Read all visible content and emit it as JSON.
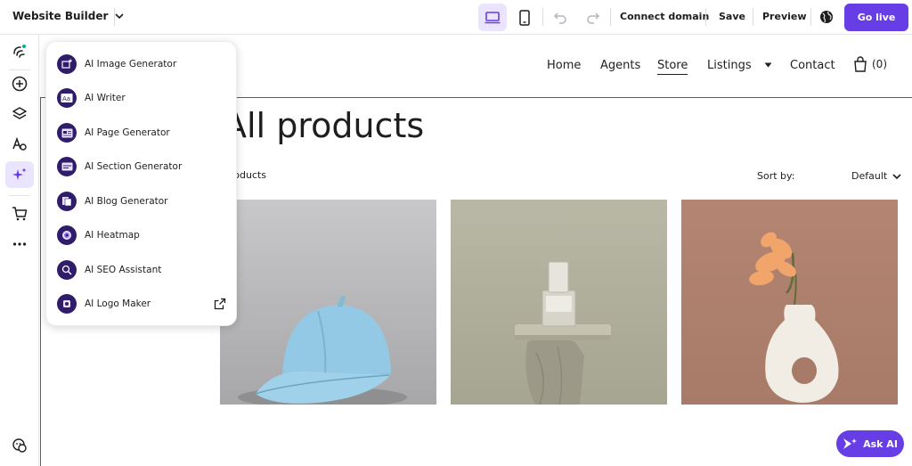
{
  "topbar": {
    "brand": "Website Builder",
    "connect_domain": "Connect domain",
    "save": "Save",
    "preview": "Preview",
    "go_live": "Go live"
  },
  "dropdown": {
    "items": [
      {
        "label": "AI Image Generator",
        "icon": "image-sparkle-icon"
      },
      {
        "label": "AI Writer",
        "icon": "text-aa-icon"
      },
      {
        "label": "AI Page Generator",
        "icon": "page-layout-icon"
      },
      {
        "label": "AI Section Generator",
        "icon": "section-layout-icon"
      },
      {
        "label": "AI Blog Generator",
        "icon": "blog-icon"
      },
      {
        "label": "AI Heatmap",
        "icon": "heatmap-icon"
      },
      {
        "label": "AI SEO Assistant",
        "icon": "seo-search-icon"
      },
      {
        "label": "AI Logo Maker",
        "icon": "logo-maker-icon"
      }
    ]
  },
  "site": {
    "nav": {
      "home": "Home",
      "agents": "Agents",
      "store": "Store",
      "listings": "Listings",
      "contact": "Contact",
      "cart_count": "(0)"
    },
    "title": "All products",
    "count_text": "products",
    "sort_label": "Sort by:",
    "sort_value": "Default"
  },
  "ask_ai": "Ask AI",
  "colors": {
    "accent": "#673de6",
    "accent_light": "#ebe4ff",
    "icon_dark": "#2f1c6a"
  }
}
